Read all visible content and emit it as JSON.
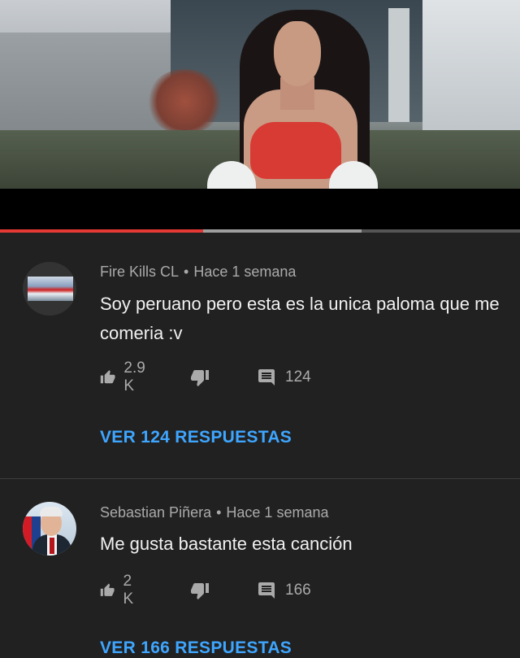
{
  "video": {
    "progress": {
      "played_fraction": 0.39,
      "buffered_fraction": 0.695
    },
    "colors": {
      "played": "#e53935",
      "buffered": "#9e9e9e",
      "track": "#555555"
    }
  },
  "comments": [
    {
      "author": "Fire Kills CL",
      "separator": "•",
      "time": "Hace 1 semana",
      "text": "Soy peruano pero esta es la unica paloma que me comeria :v",
      "likes": "2.9 K",
      "reply_count": "124",
      "view_replies": "VER 124 RESPUESTAS",
      "avatar_icon": "game-screenshot-avatar"
    },
    {
      "author": "Sebastian Piñera",
      "separator": "•",
      "time": "Hace 1 semana",
      "text": "Me gusta bastante esta canción",
      "likes": "2 K",
      "reply_count": "166",
      "view_replies": "VER 166 RESPUESTAS",
      "avatar_icon": "man-in-suit-avatar"
    }
  ],
  "icons": {
    "like": "thumbs-up-icon",
    "dislike": "thumbs-down-icon",
    "reply": "comment-icon"
  },
  "theme": {
    "background": "#212121",
    "link": "#3ea6ff",
    "muted": "#aaaaaa",
    "text": "#f1f1f1"
  }
}
